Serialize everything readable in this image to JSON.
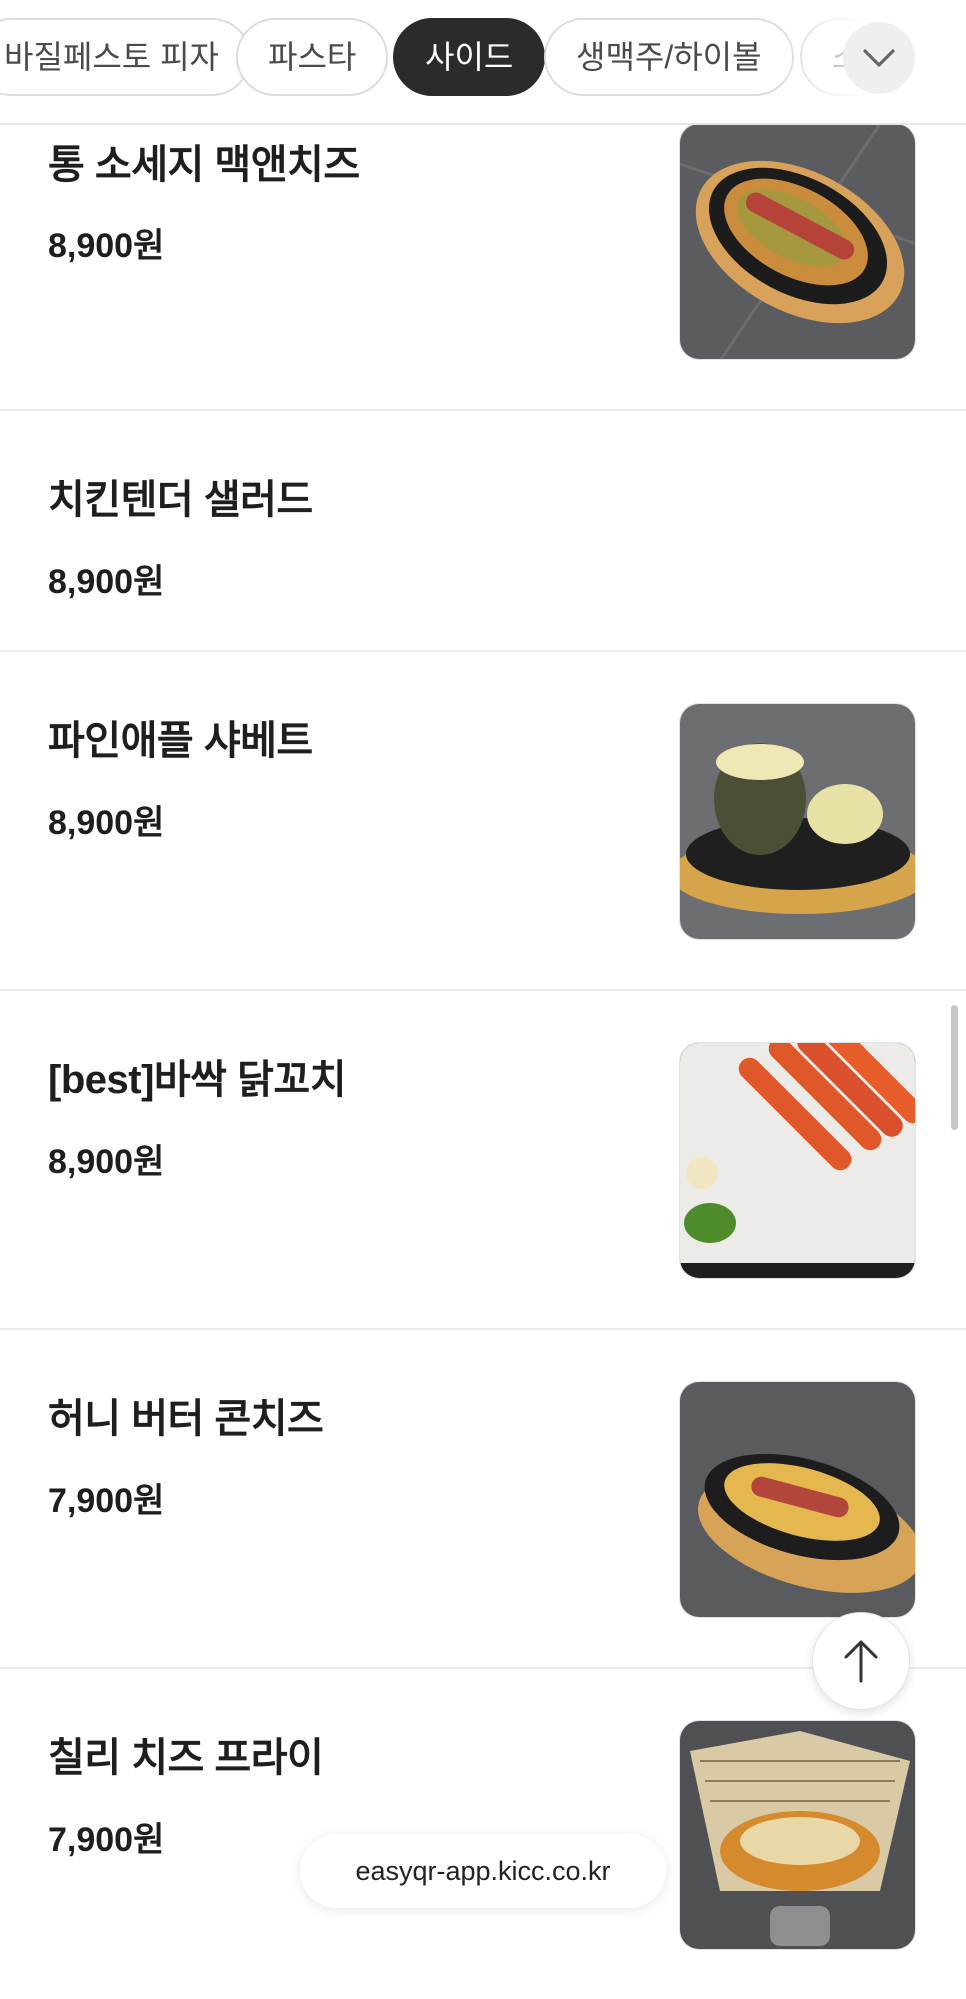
{
  "categories": {
    "tabs": [
      {
        "label": "바질페스토 피자",
        "active": false
      },
      {
        "label": "파스타",
        "active": false
      },
      {
        "label": "사이드",
        "active": true
      },
      {
        "label": "생맥주/하이볼",
        "active": false
      },
      {
        "label": "소",
        "active": false
      }
    ],
    "more_icon": "chevron-down-icon"
  },
  "menu": {
    "items": [
      {
        "name": "통 소세지 맥앤치즈",
        "price": "8,900원",
        "has_image": true,
        "image": "sausage-mac-cheese-photo"
      },
      {
        "name": "치킨텐더 샐러드",
        "price": "8,900원",
        "has_image": false
      },
      {
        "name": "파인애플 샤베트",
        "price": "8,900원",
        "has_image": true,
        "image": "pineapple-sherbet-photo"
      },
      {
        "name": "[best]바싹 닭꼬치",
        "price": "8,900원",
        "has_image": true,
        "image": "chicken-skewers-photo"
      },
      {
        "name": "허니 버터 콘치즈",
        "price": "7,900원",
        "has_image": true,
        "image": "honey-butter-corn-cheese-photo"
      },
      {
        "name": "칠리 치즈 프라이",
        "price": "7,900원",
        "has_image": true,
        "image": "chili-cheese-fries-photo"
      }
    ]
  },
  "scroll_top_icon": "arrow-up-icon",
  "url_bar": {
    "text": "easyqr-app.kicc.co.kr"
  },
  "colors": {
    "active_tab_bg": "#2b2b2b",
    "text": "#1e1e1e",
    "divider": "#ececec"
  }
}
